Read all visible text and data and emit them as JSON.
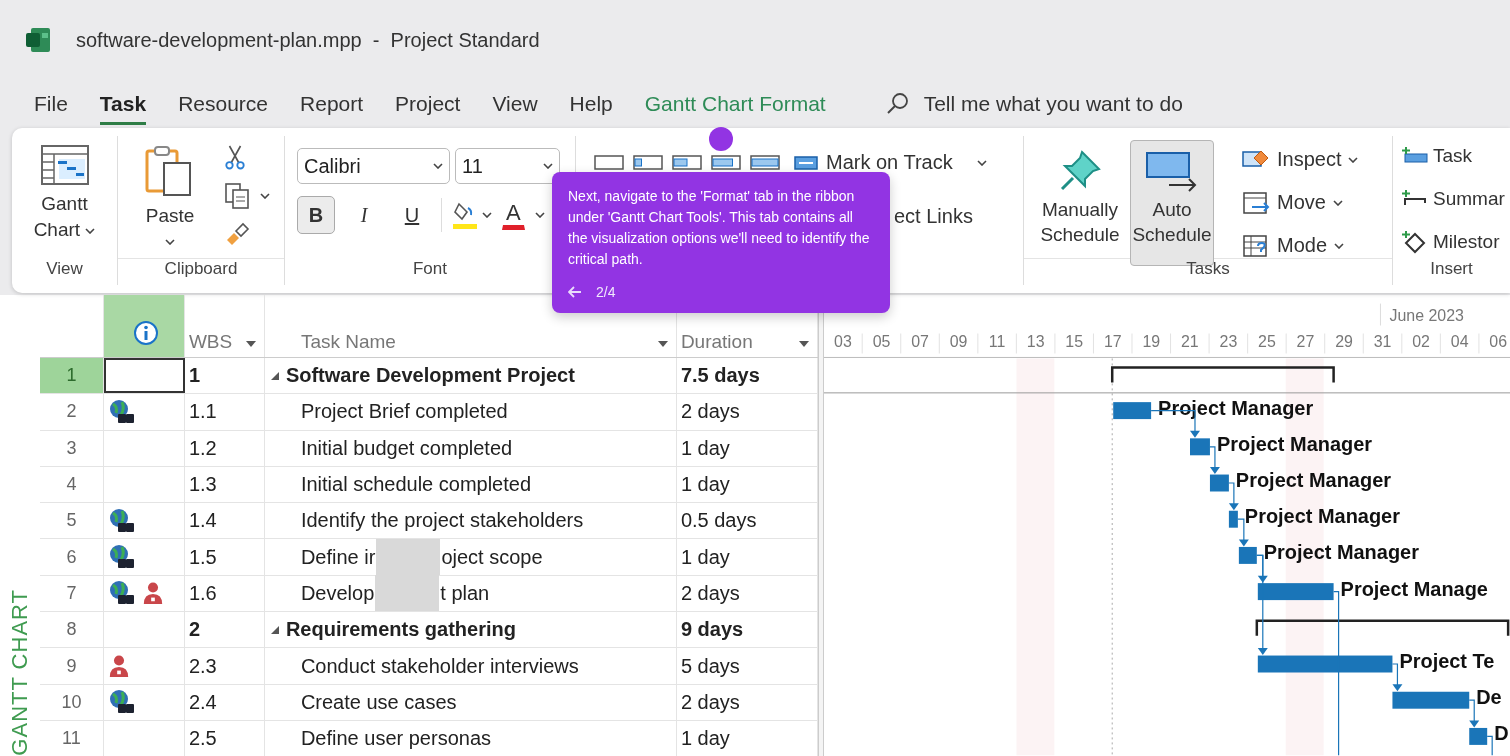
{
  "window": {
    "title": "software-development-plan.mpp  -  Project Standard"
  },
  "menu": [
    {
      "label": "File",
      "selected": false,
      "kind": "tab"
    },
    {
      "label": "Task",
      "selected": true,
      "kind": "tab"
    },
    {
      "label": "Resource",
      "selected": false,
      "kind": "tab"
    },
    {
      "label": "Report",
      "selected": false,
      "kind": "tab"
    },
    {
      "label": "Project",
      "selected": false,
      "kind": "tab"
    },
    {
      "label": "View",
      "selected": false,
      "kind": "tab"
    },
    {
      "label": "Help",
      "selected": false,
      "kind": "tab"
    },
    {
      "label": "Gantt Chart Format",
      "selected": false,
      "kind": "contextual"
    }
  ],
  "tell_me": {
    "placeholder": "Tell me what you want to do"
  },
  "ribbon": {
    "view": {
      "button": "Gantt Chart",
      "group": "View"
    },
    "clipboard": {
      "button": "Paste",
      "group": "Clipboard"
    },
    "font": {
      "family": "Calibri",
      "size": "11",
      "styles": [
        {
          "label": "B",
          "selected": true,
          "kind": "bold"
        },
        {
          "label": "I",
          "selected": false,
          "kind": "italic"
        },
        {
          "label": "U",
          "selected": false,
          "kind": "underline"
        }
      ],
      "font_color": "A",
      "group": "Font"
    },
    "schedule": {
      "mark_on_track": "Mark on Track",
      "links": "ect Links"
    },
    "tasks": {
      "buttons": [
        {
          "label": "Manually Schedule",
          "selected": false,
          "kind": "pin"
        },
        {
          "label": "Auto Schedule",
          "selected": true,
          "kind": "auto"
        }
      ],
      "menus": [
        {
          "label": "Inspect",
          "kind": "inspect"
        },
        {
          "label": "Move",
          "kind": "move"
        },
        {
          "label": "Mode",
          "kind": "mode"
        }
      ],
      "group": "Tasks"
    },
    "insert": {
      "items": [
        {
          "label": "Task",
          "kind": "task"
        },
        {
          "label": "Summar",
          "kind": "summary"
        },
        {
          "label": "Milestor",
          "kind": "milestone"
        }
      ],
      "group": "Insert"
    }
  },
  "tour": {
    "text": "Next, navigate to the 'Format' tab in the ribbon under 'Gantt Chart Tools'. This tab contains all the visualization options we'll need to identify the critical path.",
    "step": "2/4"
  },
  "side_label": "GANTT CHART",
  "table": {
    "columns": [
      "WBS",
      "Task Name",
      "Duration"
    ],
    "rows": [
      {
        "number": "1",
        "wbs": "1",
        "name": "Software Development Project",
        "duration": "7.5 days",
        "summary": true,
        "expanded": true,
        "selected": true
      },
      {
        "number": "2",
        "indicators": [
          {
            "kind": "network"
          }
        ],
        "wbs": "1.1",
        "name": "Project Brief completed",
        "duration": "2 days",
        "summary": false,
        "selected": false,
        "bar_label": "Project Manager"
      },
      {
        "number": "3",
        "wbs": "1.2",
        "name": "Initial budget completed",
        "duration": "1 day",
        "summary": false,
        "selected": false,
        "bar_label": "Project Manager"
      },
      {
        "number": "4",
        "wbs": "1.3",
        "name": "Initial schedule completed",
        "duration": "1 day",
        "summary": false,
        "selected": false,
        "bar_label": "Project Manager"
      },
      {
        "number": "5",
        "indicators": [
          {
            "kind": "network"
          }
        ],
        "wbs": "1.4",
        "name": "Identify the project stakeholders",
        "duration": "0.5 days",
        "summary": false,
        "selected": false,
        "bar_label": "Project Manager"
      },
      {
        "number": "6",
        "indicators": [
          {
            "kind": "network"
          }
        ],
        "wbs": "1.5",
        "name": "Define ir",
        "name_after": "oject scope",
        "duration": "1 day",
        "summary": false,
        "selected": false,
        "bar_label": "Project Manager"
      },
      {
        "number": "7",
        "indicators": [
          {
            "kind": "network"
          },
          {
            "kind": "person"
          }
        ],
        "wbs": "1.6",
        "name": "Develop",
        "name_after": "t plan",
        "duration": "2 days",
        "summary": false,
        "selected": false,
        "bar_label": "Project Manage"
      },
      {
        "number": "8",
        "wbs": "2",
        "name": "Requirements gathering",
        "duration": "9 days",
        "summary": true,
        "expanded": true,
        "selected": false
      },
      {
        "number": "9",
        "indicators": [
          {
            "kind": "person"
          }
        ],
        "wbs": "2.3",
        "name": "Conduct stakeholder interviews",
        "duration": "5 days",
        "summary": false,
        "selected": false,
        "bar_label": "Project Te"
      },
      {
        "number": "10",
        "indicators": [
          {
            "kind": "network"
          }
        ],
        "wbs": "2.4",
        "name": "Create use cases",
        "duration": "2 days",
        "summary": false,
        "selected": false,
        "bar_label": "De"
      },
      {
        "number": "11",
        "wbs": "2.5",
        "name": "Define user personas",
        "duration": "1 day",
        "summary": false,
        "selected": false,
        "bar_label": "D"
      }
    ]
  },
  "timeline": {
    "month": "June 2023",
    "ticks": [
      "03",
      "05",
      "07",
      "09",
      "11",
      "13",
      "15",
      "17",
      "19",
      "21",
      "23",
      "25",
      "27",
      "29",
      "31",
      "02",
      "04",
      "06"
    ]
  }
}
